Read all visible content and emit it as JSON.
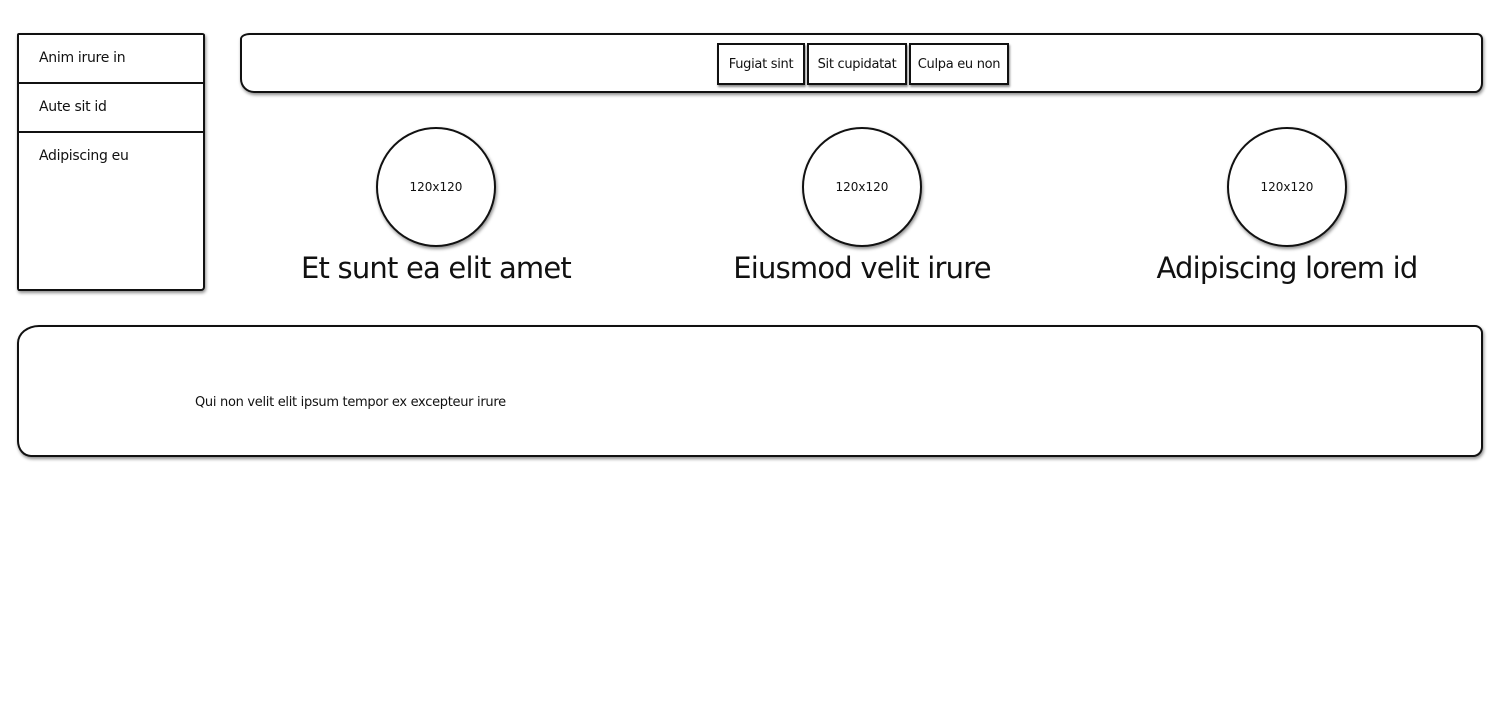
{
  "nav": {
    "items": [
      {
        "label": "Anim irure in"
      },
      {
        "label": "Aute sit id"
      },
      {
        "label": "Adipiscing eu"
      }
    ]
  },
  "toolbar": {
    "buttons": [
      {
        "label": "Fugiat sint"
      },
      {
        "label": "Sit cupidatat"
      },
      {
        "label": "Culpa eu non"
      }
    ]
  },
  "cards": [
    {
      "image_label": "120x120",
      "title": "Et sunt ea elit amet"
    },
    {
      "image_label": "120x120",
      "title": "Eiusmod velit irure"
    },
    {
      "image_label": "120x120",
      "title": "Adipiscing lorem id"
    }
  ],
  "panel": {
    "text": "Qui non velit elit ipsum tempor ex excepteur irure"
  }
}
